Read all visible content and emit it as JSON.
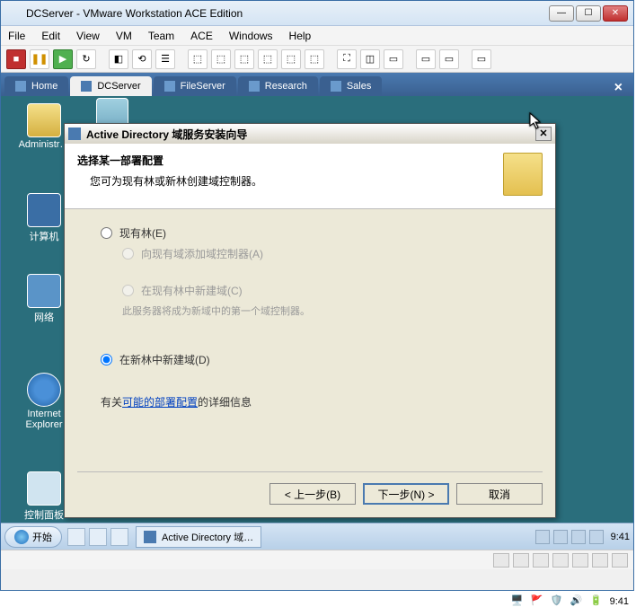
{
  "vmware": {
    "title": "DCServer - VMware Workstation ACE Edition",
    "menu": [
      "File",
      "Edit",
      "View",
      "VM",
      "Team",
      "ACE",
      "Windows",
      "Help"
    ],
    "tabs": [
      {
        "label": "Home",
        "active": false
      },
      {
        "label": "DCServer",
        "active": true
      },
      {
        "label": "FileServer",
        "active": false
      },
      {
        "label": "Research",
        "active": false
      },
      {
        "label": "Sales",
        "active": false
      }
    ]
  },
  "desktop_icons": {
    "admin": "Administr…",
    "computer": "计算机",
    "network": "网络",
    "ie": "Internet Explorer",
    "cpanel": "控制面板"
  },
  "dialog": {
    "title": "Active Directory 域服务安装向导",
    "heading": "选择某一部署配置",
    "subheading": "您可为现有林或新林创建域控制器。",
    "opt_existing_forest": "现有林(E)",
    "opt_add_dc": "向现有域添加域控制器(A)",
    "opt_new_domain_existing": "在现有林中新建域(C)",
    "helper_new_domain": "此服务器将成为新域中的第一个域控制器。",
    "opt_new_forest": "在新林中新建域(D)",
    "more_prefix": "有关",
    "more_link": "可能的部署配置",
    "more_suffix": "的详细信息",
    "btn_back": "< 上一步(B)",
    "btn_next": "下一步(N) >",
    "btn_cancel": "取消"
  },
  "taskbar": {
    "start": "开始",
    "task_item": "Active Directory 域…",
    "clock": "9:41"
  },
  "host_tray_time": "9:41"
}
